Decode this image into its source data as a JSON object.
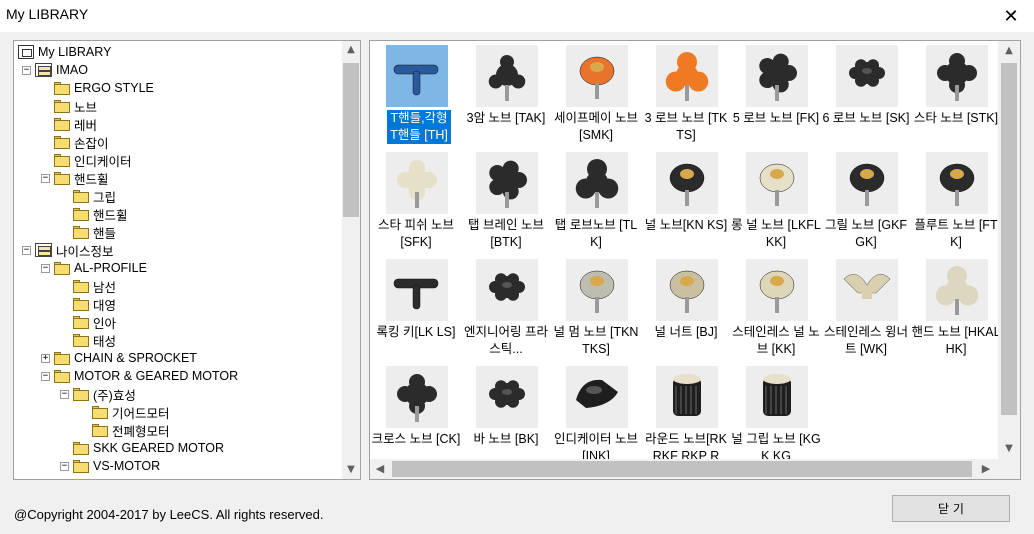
{
  "window": {
    "title": "My LIBRARY",
    "close_glyph": "✕"
  },
  "tree": [
    {
      "label": "My LIBRARY",
      "depth": 0,
      "icon": "root",
      "toggle": ""
    },
    {
      "label": "IMAO",
      "depth": 1,
      "icon": "cabinet",
      "toggle": "−"
    },
    {
      "label": "ERGO STYLE",
      "depth": 2,
      "icon": "folder",
      "toggle": ""
    },
    {
      "label": "노브",
      "depth": 2,
      "icon": "folder",
      "toggle": ""
    },
    {
      "label": "레버",
      "depth": 2,
      "icon": "folder",
      "toggle": ""
    },
    {
      "label": "손잡이",
      "depth": 2,
      "icon": "folder",
      "toggle": ""
    },
    {
      "label": "인디케이터",
      "depth": 2,
      "icon": "folder",
      "toggle": ""
    },
    {
      "label": "핸드휠",
      "depth": 2,
      "icon": "folder",
      "toggle": "−"
    },
    {
      "label": "그립",
      "depth": 3,
      "icon": "folder",
      "toggle": ""
    },
    {
      "label": "핸드휠",
      "depth": 3,
      "icon": "folder",
      "toggle": ""
    },
    {
      "label": "핸들",
      "depth": 3,
      "icon": "folder",
      "toggle": ""
    },
    {
      "label": "나이스정보",
      "depth": 1,
      "icon": "cabinet",
      "toggle": "−"
    },
    {
      "label": "AL-PROFILE",
      "depth": 2,
      "icon": "folder",
      "toggle": "−"
    },
    {
      "label": "남선",
      "depth": 3,
      "icon": "folder",
      "toggle": ""
    },
    {
      "label": "대영",
      "depth": 3,
      "icon": "folder",
      "toggle": ""
    },
    {
      "label": "인아",
      "depth": 3,
      "icon": "folder",
      "toggle": ""
    },
    {
      "label": "태성",
      "depth": 3,
      "icon": "folder",
      "toggle": ""
    },
    {
      "label": "CHAIN & SPROCKET",
      "depth": 2,
      "icon": "folder",
      "toggle": "+"
    },
    {
      "label": "MOTOR & GEARED MOTOR",
      "depth": 2,
      "icon": "folder",
      "toggle": "−"
    },
    {
      "label": "(주)효성",
      "depth": 3,
      "icon": "folder",
      "toggle": "−"
    },
    {
      "label": "기어드모터",
      "depth": 4,
      "icon": "folder",
      "toggle": ""
    },
    {
      "label": "전폐형모터",
      "depth": 4,
      "icon": "folder",
      "toggle": ""
    },
    {
      "label": "SKK GEARED MOTOR",
      "depth": 3,
      "icon": "folder",
      "toggle": ""
    },
    {
      "label": "VS-MOTOR",
      "depth": 3,
      "icon": "folder",
      "toggle": "−"
    }
  ],
  "items": [
    {
      "label": "T핸들,각형 T핸들 [TH]",
      "color": "#2a5a9e",
      "shape": "thandle",
      "selected": true
    },
    {
      "label": "3암 노브 [TAK]",
      "color": "#2b2b2b",
      "shape": "arm3"
    },
    {
      "label": "세이프메이 노브 [SMK]",
      "color": "#e8732a",
      "shape": "round"
    },
    {
      "label": "3 로브 노브 [TKTS]",
      "color": "#f07a22",
      "shape": "lobe3"
    },
    {
      "label": "5 로브 노브 [FK]",
      "color": "#2b2b2b",
      "shape": "lobe5"
    },
    {
      "label": "6 로브 노브 [SK]",
      "color": "#2b2b2b",
      "shape": "lobe6"
    },
    {
      "label": "스타 노브 [STK]",
      "color": "#2b2b2b",
      "shape": "star"
    },
    {
      "label": "스타 피쉬 노브 [SFK]",
      "color": "#e6e0c8",
      "shape": "star"
    },
    {
      "label": "탭 브레인 노브 [BTK]",
      "color": "#2b2b2b",
      "shape": "lobe5"
    },
    {
      "label": "탭 로브노브 [TLK]",
      "color": "#2b2b2b",
      "shape": "lobe3"
    },
    {
      "label": "널 노브[KN KS]",
      "color": "#2b2b2b",
      "shape": "round"
    },
    {
      "label": "롱 널 노브 [LKFLKK]",
      "color": "#e6e0c8",
      "shape": "round"
    },
    {
      "label": "그릴 노브 [GKFGK]",
      "color": "#2b2b2b",
      "shape": "round"
    },
    {
      "label": "플루트 노브 [FTK]",
      "color": "#2b2b2b",
      "shape": "round"
    },
    {
      "label": "록킹 키[LK LS]",
      "color": "#2b2b2b",
      "shape": "thandle"
    },
    {
      "label": "엔지니어링 프라스틱...",
      "color": "#2b2b2b",
      "shape": "lobe6"
    },
    {
      "label": "널 멈 노브 [TKNTKS]",
      "color": "#bdbdb0",
      "shape": "round"
    },
    {
      "label": "널 너트 [BJ]",
      "color": "#c8c0a0",
      "shape": "round"
    },
    {
      "label": "스테인레스 널 노브 [KK]",
      "color": "#ddd6b8",
      "shape": "round"
    },
    {
      "label": "스테인레스 윙너트 [WK]",
      "color": "#d8d0b0",
      "shape": "wing"
    },
    {
      "label": "핸드 노브 [HKALHK]",
      "color": "#ddd6c0",
      "shape": "lobe3"
    },
    {
      "label": "크로스 노브 [CK]",
      "color": "#2b2b2b",
      "shape": "star"
    },
    {
      "label": "바 노브 [BK]",
      "color": "#2b2b2b",
      "shape": "lobe6"
    },
    {
      "label": "인디케이터 노브 [INK]",
      "color": "#1e1e1e",
      "shape": "pointer"
    },
    {
      "label": "라운드 노브[RKRKF RKP R",
      "color": "#1e1e1e",
      "shape": "cylinder"
    },
    {
      "label": "널 그립 노브 [KGK KG",
      "color": "#1e1e1e",
      "shape": "cylinder"
    }
  ],
  "footer": {
    "copyright": "@Copyright 2004-2017 by LeeCS. All rights reserved.",
    "close_label": "닫 기"
  },
  "scroll": {
    "up": "▲",
    "down": "▼",
    "left": "◀",
    "right": "▶"
  }
}
